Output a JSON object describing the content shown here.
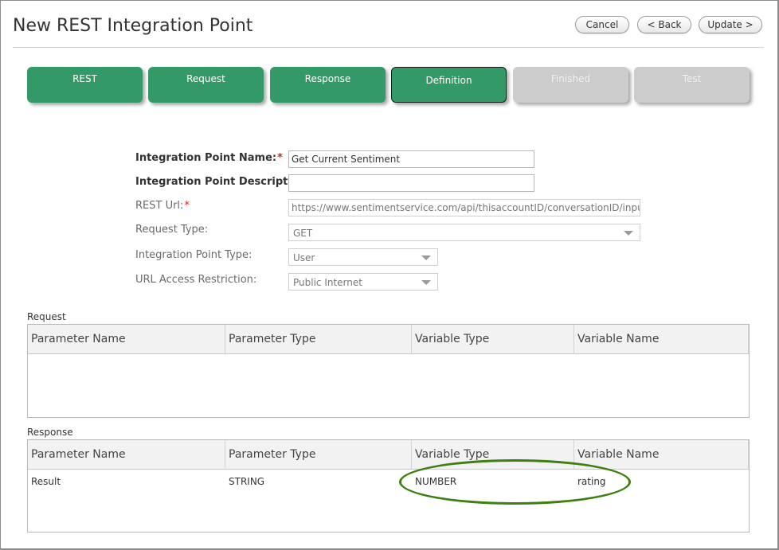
{
  "header": {
    "title": "New REST Integration Point",
    "cancel_label": "Cancel",
    "back_label": "< Back",
    "update_label": "Update >"
  },
  "steps": [
    {
      "label": "REST",
      "state": "complete"
    },
    {
      "label": "Request",
      "state": "complete"
    },
    {
      "label": "Response",
      "state": "complete"
    },
    {
      "label": "Definition",
      "state": "current"
    },
    {
      "label": "Finished",
      "state": "disabled"
    },
    {
      "label": "Test",
      "state": "disabled"
    }
  ],
  "form": {
    "name_label": "Integration Point Name:",
    "name_value": "Get Current Sentiment",
    "desc_label": "Integration Point Description:",
    "desc_value": "",
    "url_label": "REST Url:",
    "url_value": "https://www.sentimentservice.com/api/thisaccountID/conversationID/inputID",
    "request_type_label": "Request Type:",
    "request_type_value": "GET",
    "ip_type_label": "Integration Point Type:",
    "ip_type_value": "User",
    "access_label": "URL Access Restriction:",
    "access_value": "Public Internet",
    "required_marker": "*"
  },
  "request_table": {
    "title": "Request",
    "columns": [
      "Parameter Name",
      "Parameter Type",
      "Variable Type",
      "Variable Name"
    ],
    "rows": []
  },
  "response_table": {
    "title": "Response",
    "columns": [
      "Parameter Name",
      "Parameter Type",
      "Variable Type",
      "Variable Name"
    ],
    "rows": [
      [
        "Result",
        "STRING",
        "NUMBER",
        "rating"
      ]
    ]
  },
  "colors": {
    "step_active": "#339966",
    "step_disabled": "#cccccc",
    "required": "#cc2222",
    "highlight_ellipse": "#3f7f12"
  }
}
